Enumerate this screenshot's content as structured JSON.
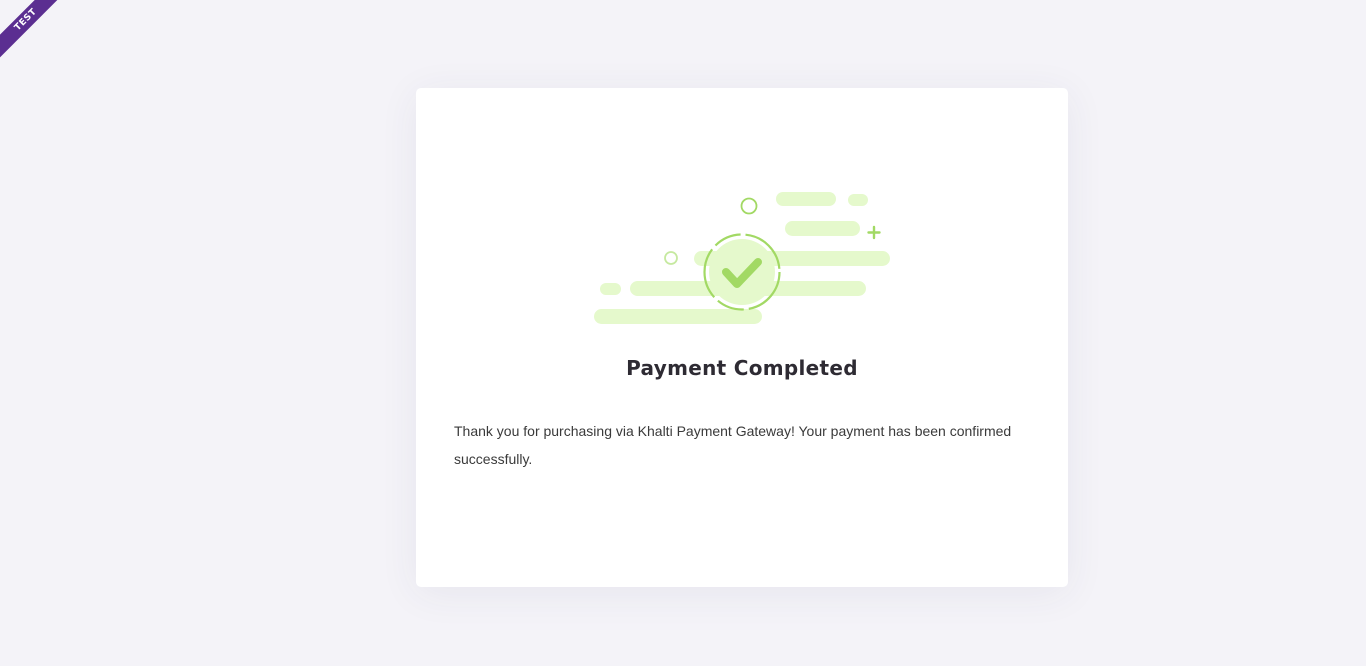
{
  "environment_badge": "TEST",
  "result": {
    "icon": "check-circle-icon",
    "title": "Payment Completed",
    "message": "Thank you for purchasing via Khalti Payment Gateway! Your payment has been confirmed successfully."
  },
  "colors": {
    "background": "#f4f3f8",
    "card": "#ffffff",
    "accent_green": "#a2d964",
    "cloud_green": "#e5f9cc",
    "ribbon": "#5b2e91"
  }
}
